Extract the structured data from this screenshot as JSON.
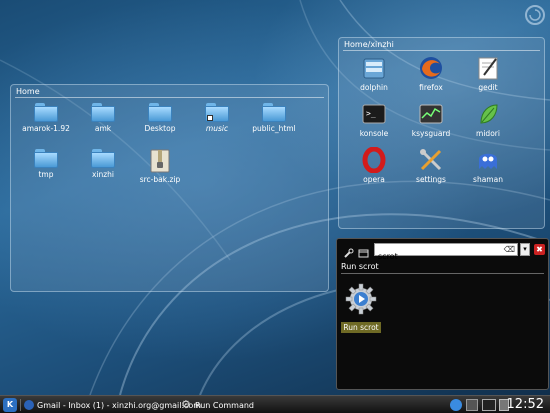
{
  "home_panel": {
    "title": "Home",
    "items": [
      {
        "label": "amarok-1.92",
        "italic": false
      },
      {
        "label": "amk",
        "italic": false
      },
      {
        "label": "Desktop",
        "italic": false
      },
      {
        "label": "music",
        "italic": true
      },
      {
        "label": "public_html",
        "italic": false
      },
      {
        "label": "tmp",
        "italic": false
      },
      {
        "label": "xinzhi",
        "italic": false
      },
      {
        "label": "src-bak.zip",
        "italic": false
      }
    ]
  },
  "xinzhi_panel": {
    "title": "Home/xinzhi",
    "items": [
      {
        "label": "dolphin",
        "icon": "dolphin-icon"
      },
      {
        "label": "firefox",
        "icon": "firefox-icon"
      },
      {
        "label": "gedit",
        "icon": "gedit-icon"
      },
      {
        "label": "konsole",
        "icon": "konsole-icon"
      },
      {
        "label": "ksysguard",
        "icon": "ksysguard-icon"
      },
      {
        "label": "midori",
        "icon": "midori-icon"
      },
      {
        "label": "opera",
        "icon": "opera-icon"
      },
      {
        "label": "settings",
        "icon": "settings-icon"
      },
      {
        "label": "shaman",
        "icon": "shaman-icon"
      }
    ]
  },
  "run_dialog": {
    "query": "scrot",
    "result_header": "Run scrot",
    "result_label": "Run scrot",
    "close_glyph": "✖",
    "dropdown_glyph": "▾"
  },
  "taskbar": {
    "tasks": [
      {
        "label": "Gmail - Inbox (1) - xinzhi.org@gmail.com"
      },
      {
        "label": "Run Command"
      }
    ],
    "clock": "12:52"
  }
}
